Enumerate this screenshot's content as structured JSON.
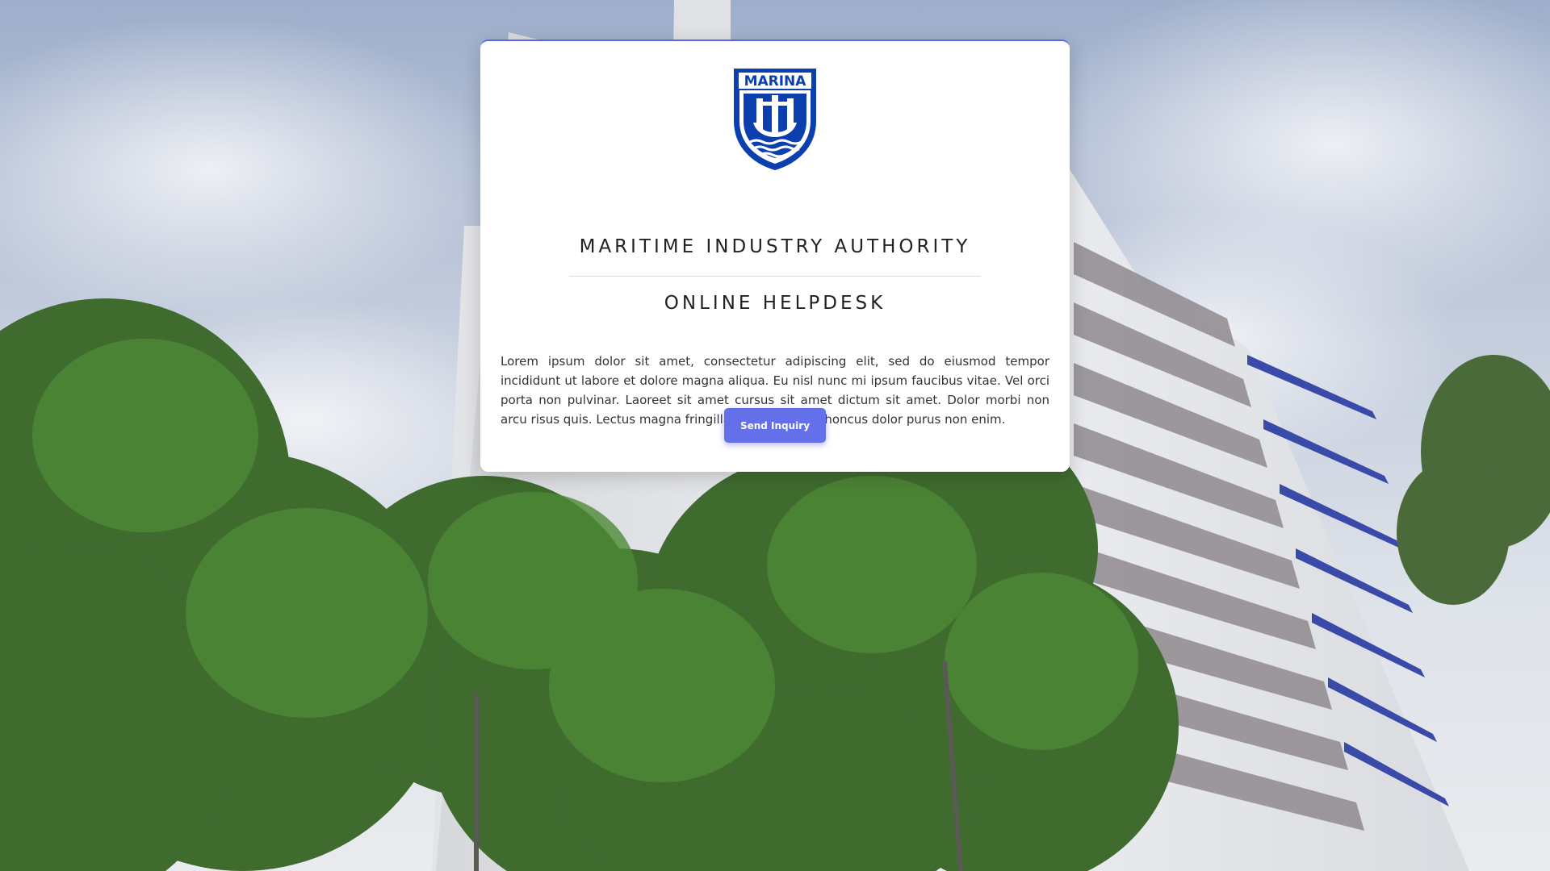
{
  "header": {
    "logo_text": "MARINA",
    "title": "MARITIME INDUSTRY AUTHORITY",
    "subtitle": "ONLINE HELPDESK"
  },
  "main": {
    "description": "Lorem ipsum dolor sit amet, consectetur adipiscing elit, sed do eiusmod tempor incididunt ut labore et dolore magna aliqua. Eu nisl nunc mi ipsum faucibus vitae. Vel orci porta non pulvinar. Laoreet sit amet cursus sit amet dictum sit amet. Dolor morbi non arcu risus quis. Lectus magna fringilla urna porttitor rhoncus dolor purus non enim.",
    "send_button_label": "Send Inquiry"
  },
  "colors": {
    "accent": "#6370ea",
    "logo_blue": "#0b3fae"
  }
}
